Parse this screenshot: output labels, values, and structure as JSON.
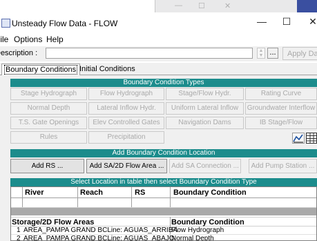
{
  "window": {
    "title": "Unsteady Flow Data - FLOW",
    "minimize_glyph": "—",
    "maximize_glyph": "☐",
    "close_glyph": "✕"
  },
  "background_window": {
    "minimize_glyph": "—",
    "maximize_glyph": "☐",
    "close_glyph": "✕"
  },
  "menu": [
    "File",
    "Options",
    "Help"
  ],
  "description": {
    "label": "Description :",
    "value": "",
    "browse_label": "...",
    "apply_label": "Apply Data"
  },
  "tabs": [
    {
      "label": "Boundary Conditions",
      "active": true
    },
    {
      "label": "Initial Conditions",
      "active": false
    }
  ],
  "boundary_types": {
    "header": "Boundary Condition Types",
    "buttons": [
      [
        "Stage Hydrograph",
        "Flow Hydrograph",
        "Stage/Flow Hydr.",
        "Rating Curve"
      ],
      [
        "Normal Depth",
        "Lateral Inflow Hydr.",
        "Uniform Lateral Inflow",
        "Groundwater Interflow"
      ],
      [
        "T.S. Gate Openings",
        "Elev Controlled Gates",
        "Navigation Dams",
        "IB Stage/Flow"
      ],
      [
        "Rules",
        "Precipitation"
      ]
    ],
    "icons": [
      "plot-icon",
      "table-icon"
    ]
  },
  "add_location": {
    "header": "Add Boundary Condition Location",
    "buttons": [
      "Add RS ...",
      "Add SA/2D Flow Area ...",
      "Add SA Connection ...",
      "Add Pump Station ..."
    ]
  },
  "table": {
    "header": "Select Location in table then select Boundary Condition Type",
    "columns": [
      "River",
      "Reach",
      "RS",
      "Boundary Condition"
    ],
    "storage_header": "Storage/2D Flow Areas",
    "storage_bc_header": "Boundary Condition",
    "rows": [
      {
        "num": "1",
        "location": "AREA_PAMPA GRAND BCLine: AGUAS_ARRIBA",
        "bc": "Flow Hydrograph"
      },
      {
        "num": "2",
        "location": "AREA_PAMPA GRAND BCLine: AGUAS_ABAJO",
        "bc": "Normal Depth"
      }
    ]
  },
  "colors": {
    "section_header": "#1c8c8c",
    "window_bg": "#f0f0f0"
  }
}
